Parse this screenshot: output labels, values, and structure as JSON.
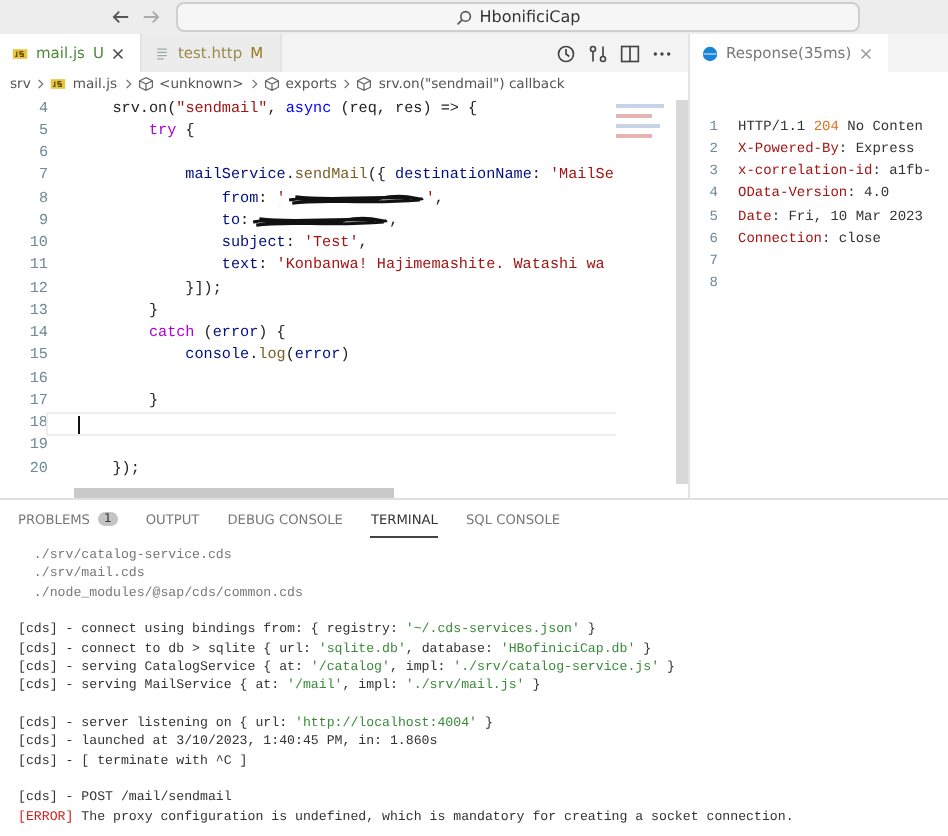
{
  "title_bar": {
    "search": "HbonificiCap"
  },
  "editor_tabs": [
    {
      "label": "mail.js",
      "badge": "U",
      "selected": true,
      "kind": "js"
    },
    {
      "label": "test.http",
      "badge": "M",
      "selected": false,
      "kind": "http"
    }
  ],
  "breadcrumbs": [
    {
      "label": "srv",
      "kind": "folder"
    },
    {
      "label": "mail.js",
      "kind": "js"
    },
    {
      "label": "<unknown>",
      "kind": "symbol"
    },
    {
      "label": "exports",
      "kind": "symbol"
    },
    {
      "label": "srv.on(\"sendmail\") callback",
      "kind": "symbol"
    }
  ],
  "code": [
    {
      "n": "4",
      "segs": [
        {
          "kind": "plain",
          "text": "    srv.on("
        },
        {
          "kind": "str",
          "text": "\"sendmail\""
        },
        {
          "kind": "plain",
          "text": ", "
        },
        {
          "kind": "kw",
          "text": "async"
        },
        {
          "kind": "plain",
          "text": " (req, res) => {"
        }
      ]
    },
    {
      "n": "5",
      "segs": [
        {
          "kind": "ctrl",
          "text": "        try"
        },
        {
          "kind": "plain",
          "text": " {"
        }
      ]
    },
    {
      "n": "6"
    },
    {
      "n": "7",
      "segs": [
        {
          "kind": "var",
          "text": "            mailService"
        },
        {
          "kind": "plain",
          "text": "."
        },
        {
          "kind": "fn",
          "text": "sendMail"
        },
        {
          "kind": "plain",
          "text": "({ "
        },
        {
          "kind": "var",
          "text": "destinationName"
        },
        {
          "kind": "plain",
          "text": ": "
        },
        {
          "kind": "str",
          "text": "'MailSe"
        }
      ]
    },
    {
      "n": "8",
      "segs": [
        {
          "kind": "var",
          "text": "                from"
        },
        {
          "kind": "plain",
          "text": ": "
        },
        {
          "kind": "str",
          "text": "'"
        },
        {
          "kind": "redacted"
        },
        {
          "kind": "str",
          "text": "'"
        },
        {
          "kind": "plain",
          "text": ","
        }
      ]
    },
    {
      "n": "9",
      "segs": [
        {
          "kind": "var",
          "text": "                to"
        },
        {
          "kind": "plain",
          "text": ":"
        },
        {
          "kind": "redacted"
        },
        {
          "kind": "plain",
          "text": ","
        }
      ]
    },
    {
      "n": "10",
      "segs": [
        {
          "kind": "var",
          "text": "                subject"
        },
        {
          "kind": "plain",
          "text": ": "
        },
        {
          "kind": "str",
          "text": "'Test'"
        },
        {
          "kind": "plain",
          "text": ","
        }
      ]
    },
    {
      "n": "11",
      "segs": [
        {
          "kind": "var",
          "text": "                text"
        },
        {
          "kind": "plain",
          "text": ": "
        },
        {
          "kind": "str",
          "text": "'Konbanwa! Hajimemashite. Watashi wa"
        }
      ]
    },
    {
      "n": "12",
      "segs": [
        {
          "kind": "plain",
          "text": "            }]);"
        }
      ]
    },
    {
      "n": "13",
      "segs": [
        {
          "kind": "plain",
          "text": "        }"
        }
      ]
    },
    {
      "n": "14",
      "segs": [
        {
          "kind": "ctrl",
          "text": "        catch"
        },
        {
          "kind": "plain",
          "text": " ("
        },
        {
          "kind": "var",
          "text": "error"
        },
        {
          "kind": "plain",
          "text": ") {"
        }
      ]
    },
    {
      "n": "15",
      "segs": [
        {
          "kind": "var",
          "text": "            console"
        },
        {
          "kind": "plain",
          "text": "."
        },
        {
          "kind": "fn",
          "text": "log"
        },
        {
          "kind": "plain",
          "text": "("
        },
        {
          "kind": "var",
          "text": "error"
        },
        {
          "kind": "plain",
          "text": ")"
        }
      ]
    },
    {
      "n": "16"
    },
    {
      "n": "17",
      "segs": [
        {
          "kind": "plain",
          "text": "        }"
        }
      ]
    },
    {
      "n": "18",
      "cursor": true
    },
    {
      "n": "19"
    },
    {
      "n": "20",
      "segs": [
        {
          "kind": "plain",
          "text": "    });"
        }
      ]
    }
  ],
  "response": {
    "tab": "Response(35ms)",
    "lines": [
      {
        "n": "1",
        "segs": [
          {
            "kind": "plain",
            "text": "HTTP/1.1 "
          },
          {
            "kind": "num",
            "text": "204"
          },
          {
            "kind": "plain",
            "text": " No Conten"
          }
        ]
      },
      {
        "n": "2",
        "segs": [
          {
            "kind": "hdr",
            "text": "X-Powered-By"
          },
          {
            "kind": "plain",
            "text": ": Express"
          }
        ]
      },
      {
        "n": "3",
        "segs": [
          {
            "kind": "hdr",
            "text": "x-correlation-id"
          },
          {
            "kind": "plain",
            "text": ": a1fb-"
          }
        ]
      },
      {
        "n": "4",
        "segs": [
          {
            "kind": "hdr",
            "text": "OData-Version"
          },
          {
            "kind": "plain",
            "text": ": 4.0"
          }
        ]
      },
      {
        "n": "5",
        "segs": [
          {
            "kind": "hdr",
            "text": "Date"
          },
          {
            "kind": "plain",
            "text": ": Fri, 10 Mar 2023"
          }
        ]
      },
      {
        "n": "6",
        "segs": [
          {
            "kind": "hdr",
            "text": "Connection"
          },
          {
            "kind": "plain",
            "text": ": close"
          }
        ]
      },
      {
        "n": "7"
      },
      {
        "n": "8"
      }
    ]
  },
  "panel_tabs": [
    {
      "label": "PROBLEMS",
      "badge": "1",
      "selected": false
    },
    {
      "label": "OUTPUT",
      "selected": false
    },
    {
      "label": "DEBUG CONSOLE",
      "selected": false
    },
    {
      "label": "TERMINAL",
      "selected": true
    },
    {
      "label": "SQL CONSOLE",
      "selected": false
    }
  ],
  "terminal": [
    [
      [
        {
          "kind": "dim",
          "text": "  ./srv/catalog-service.cds"
        }
      ],
      [
        {
          "kind": "dim",
          "text": "  ./srv/mail.cds"
        }
      ],
      [
        {
          "kind": "dim",
          "text": "  ./node_modules/@sap/cds/common.cds"
        }
      ]
    ],
    [
      [
        {
          "kind": "plain",
          "text": "[cds] - connect using bindings from: { registry: "
        },
        {
          "kind": "str",
          "text": "'~/.cds-services.json'"
        },
        {
          "kind": "plain",
          "text": " }"
        }
      ],
      [
        {
          "kind": "plain",
          "text": "[cds] - connect to db > sqlite { url: "
        },
        {
          "kind": "str",
          "text": "'sqlite.db'"
        },
        {
          "kind": "plain",
          "text": ", database: "
        },
        {
          "kind": "str",
          "text": "'HBofiniciCap.db'"
        },
        {
          "kind": "plain",
          "text": " }"
        }
      ],
      [
        {
          "kind": "plain",
          "text": "[cds] - serving CatalogService { at: "
        },
        {
          "kind": "str",
          "text": "'/catalog'"
        },
        {
          "kind": "plain",
          "text": ", impl: "
        },
        {
          "kind": "str",
          "text": "'./srv/catalog-service.js'"
        },
        {
          "kind": "plain",
          "text": " }"
        }
      ],
      [
        {
          "kind": "plain",
          "text": "[cds] - serving MailService { at: "
        },
        {
          "kind": "str",
          "text": "'/mail'"
        },
        {
          "kind": "plain",
          "text": ", impl: "
        },
        {
          "kind": "str",
          "text": "'./srv/mail.js'"
        },
        {
          "kind": "plain",
          "text": " }"
        }
      ]
    ],
    [
      [
        {
          "kind": "plain",
          "text": "[cds] - server listening on { url: "
        },
        {
          "kind": "str",
          "text": "'http://localhost:4004'"
        },
        {
          "kind": "plain",
          "text": " }"
        }
      ],
      [
        {
          "kind": "plain",
          "text": "[cds] - launched at 3/10/2023, 1:40:45 PM, in: 1.860s"
        }
      ],
      [
        {
          "kind": "plain",
          "text": "[cds] - [ terminate with ^C ]"
        }
      ]
    ],
    [
      [
        {
          "kind": "plain",
          "text": "[cds] - POST /mail/sendmail"
        }
      ],
      [
        {
          "kind": "err",
          "text": "[ERROR]"
        },
        {
          "kind": "plain",
          "text": " The proxy configuration is undefined, which is mandatory for creating a socket connection."
        }
      ]
    ]
  ]
}
